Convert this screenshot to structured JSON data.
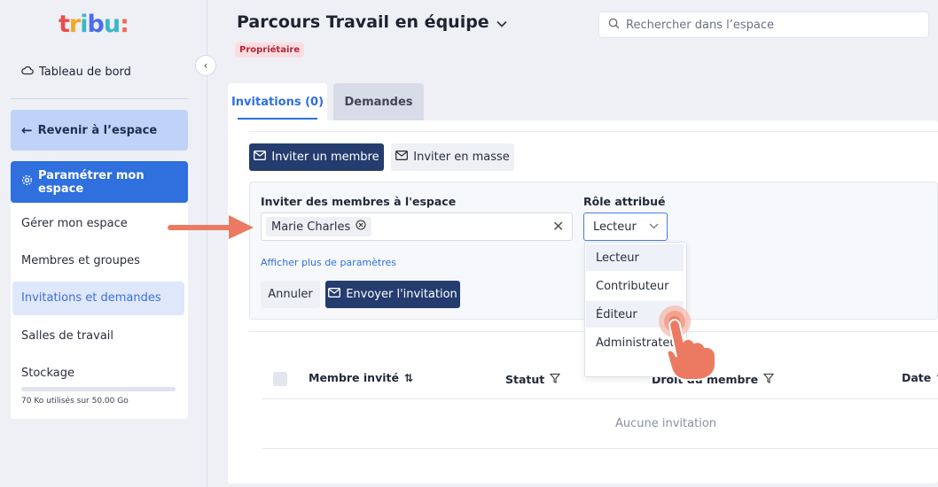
{
  "logo": {
    "text": "tribu:"
  },
  "sidebar": {
    "dashboard_label": "Tableau de bord",
    "back_label": "Revenir à l’espace",
    "settings_label": "Paramétrer mon espace",
    "items": [
      {
        "label": "Gérer mon espace"
      },
      {
        "label": "Membres et groupes"
      },
      {
        "label": "Invitations et demandes"
      },
      {
        "label": "Salles de travail"
      },
      {
        "label": "Stockage"
      }
    ],
    "storage_text": "70 Ko utilisés sur 50.00 Go",
    "storage_used_fraction": 0.0
  },
  "header": {
    "title": "Parcours Travail en équipe",
    "badge": "Propriétaire",
    "search_placeholder": "Rechercher dans l’espace"
  },
  "tabs": [
    {
      "label": "Invitations (0)"
    },
    {
      "label": "Demandes"
    }
  ],
  "actions": {
    "invite_member": "Inviter un membre",
    "invite_bulk": "Inviter en masse"
  },
  "form": {
    "invite_label": "Inviter des membres à l'espace",
    "chip": "Marie Charles",
    "role_label": "Rôle attribué",
    "role_value": "Lecteur",
    "more_params": "Afficher plus de paramètres",
    "cancel": "Annuler",
    "send": "Envoyer l'invitation"
  },
  "role_options": [
    {
      "label": "Lecteur"
    },
    {
      "label": "Contributeur"
    },
    {
      "label": "Éditeur"
    },
    {
      "label": "Administrateur"
    }
  ],
  "table": {
    "col_member": "Membre invité",
    "col_status": "Statut",
    "col_rights": "Droit du membre",
    "col_date": "Date",
    "empty": "Aucune invitation"
  },
  "colors": {
    "primary": "#2f6fde",
    "dark_button": "#243c6e",
    "badge_bg": "#fbdde0",
    "annotation": "#ec7a62"
  }
}
